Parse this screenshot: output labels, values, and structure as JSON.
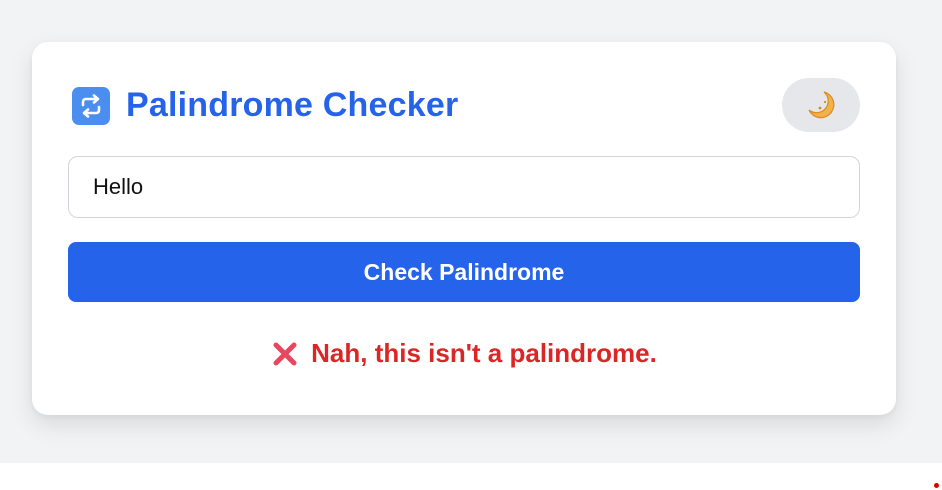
{
  "app": {
    "title": "Palindrome Checker",
    "icon": "repeat-arrows-icon",
    "accent_color": "#2563eb"
  },
  "theme_toggle": {
    "icon": "crescent-moon-icon",
    "background": "#e5e7eb"
  },
  "input": {
    "value": "Hello",
    "placeholder": ""
  },
  "check_button": {
    "label": "Check Palindrome"
  },
  "result": {
    "icon": "cross-mark-icon",
    "text": "Nah, this isn't a palindrome.",
    "color": "#dc2626"
  }
}
